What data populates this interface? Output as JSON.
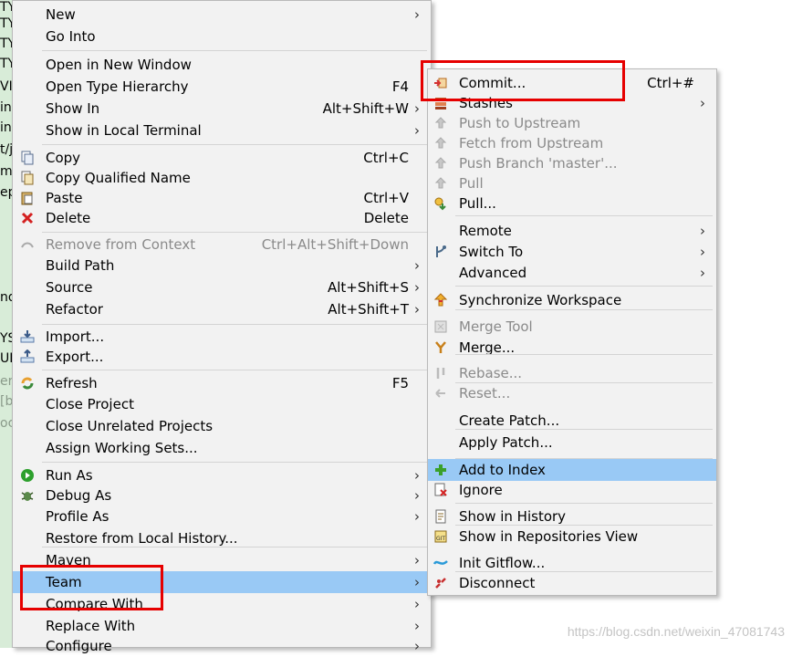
{
  "editor_fragments": [
    {
      "text": "TY",
      "muted": false
    },
    {
      "text": "TY",
      "muted": false
    },
    {
      "text": "TY",
      "muted": false
    },
    {
      "text": "TY",
      "muted": false
    },
    {
      "text": "VI",
      "muted": false
    },
    {
      "text": "in,",
      "muted": false
    },
    {
      "text": "in,",
      "muted": false
    },
    {
      "text": "t/j",
      "muted": false
    },
    {
      "text": "m",
      "muted": false
    },
    {
      "text": "ep",
      "muted": false
    },
    {
      "text": "nd",
      "muted": false
    },
    {
      "text": "YS",
      "muted": false
    },
    {
      "text": "UI",
      "muted": false
    },
    {
      "text": "er",
      "muted": true
    },
    {
      "text": "[b",
      "muted": true
    },
    {
      "text": "oc",
      "muted": true
    }
  ],
  "main_menu": {
    "items": [
      {
        "label": "New",
        "accel": "",
        "submenu": true,
        "disabled": false,
        "icon": ""
      },
      {
        "label": "Go Into",
        "accel": "",
        "submenu": false,
        "disabled": false,
        "icon": ""
      },
      {
        "label": "Open in New Window",
        "accel": "",
        "submenu": false,
        "disabled": false,
        "icon": ""
      },
      {
        "label": "Open Type Hierarchy",
        "accel": "F4",
        "submenu": false,
        "disabled": false,
        "icon": ""
      },
      {
        "label": "Show In",
        "accel": "Alt+Shift+W",
        "submenu": true,
        "disabled": false,
        "icon": ""
      },
      {
        "label": "Show in Local Terminal",
        "accel": "",
        "submenu": true,
        "disabled": false,
        "icon": ""
      },
      {
        "label": "Copy",
        "accel": "Ctrl+C",
        "submenu": false,
        "disabled": false,
        "icon": "copy-icon"
      },
      {
        "label": "Copy Qualified Name",
        "accel": "",
        "submenu": false,
        "disabled": false,
        "icon": "copy-qualified-icon"
      },
      {
        "label": "Paste",
        "accel": "Ctrl+V",
        "submenu": false,
        "disabled": false,
        "icon": "paste-icon"
      },
      {
        "label": "Delete",
        "accel": "Delete",
        "submenu": false,
        "disabled": false,
        "icon": "delete-icon"
      },
      {
        "label": "Remove from Context",
        "accel": "Ctrl+Alt+Shift+Down",
        "submenu": false,
        "disabled": true,
        "icon": "remove-context-icon"
      },
      {
        "label": "Build Path",
        "accel": "",
        "submenu": true,
        "disabled": false,
        "icon": ""
      },
      {
        "label": "Source",
        "accel": "Alt+Shift+S",
        "submenu": true,
        "disabled": false,
        "icon": ""
      },
      {
        "label": "Refactor",
        "accel": "Alt+Shift+T",
        "submenu": true,
        "disabled": false,
        "icon": ""
      },
      {
        "label": "Import...",
        "accel": "",
        "submenu": false,
        "disabled": false,
        "icon": "import-icon"
      },
      {
        "label": "Export...",
        "accel": "",
        "submenu": false,
        "disabled": false,
        "icon": "export-icon"
      },
      {
        "label": "Refresh",
        "accel": "F5",
        "submenu": false,
        "disabled": false,
        "icon": "refresh-icon"
      },
      {
        "label": "Close Project",
        "accel": "",
        "submenu": false,
        "disabled": false,
        "icon": ""
      },
      {
        "label": "Close Unrelated Projects",
        "accel": "",
        "submenu": false,
        "disabled": false,
        "icon": ""
      },
      {
        "label": "Assign Working Sets...",
        "accel": "",
        "submenu": false,
        "disabled": false,
        "icon": ""
      },
      {
        "label": "Run As",
        "accel": "",
        "submenu": true,
        "disabled": false,
        "icon": "run-icon"
      },
      {
        "label": "Debug As",
        "accel": "",
        "submenu": true,
        "disabled": false,
        "icon": "debug-icon"
      },
      {
        "label": "Profile As",
        "accel": "",
        "submenu": true,
        "disabled": false,
        "icon": ""
      },
      {
        "label": "Restore from Local History...",
        "accel": "",
        "submenu": false,
        "disabled": false,
        "icon": ""
      },
      {
        "label": "Maven",
        "accel": "",
        "submenu": true,
        "disabled": false,
        "icon": ""
      },
      {
        "label": "Team",
        "accel": "",
        "submenu": true,
        "disabled": false,
        "icon": "",
        "highlighted": true
      },
      {
        "label": "Compare With",
        "accel": "",
        "submenu": true,
        "disabled": false,
        "icon": ""
      },
      {
        "label": "Replace With",
        "accel": "",
        "submenu": true,
        "disabled": false,
        "icon": ""
      },
      {
        "label": "Configure",
        "accel": "",
        "submenu": true,
        "disabled": false,
        "icon": ""
      }
    ]
  },
  "team_menu": {
    "items": [
      {
        "label": "Commit...",
        "accel": "Ctrl+#",
        "submenu": false,
        "disabled": false,
        "icon": "commit-icon"
      },
      {
        "label": "Stashes",
        "accel": "",
        "submenu": true,
        "disabled": false,
        "icon": "stashes-icon"
      },
      {
        "label": "Push to Upstream",
        "accel": "",
        "submenu": false,
        "disabled": true,
        "icon": "push-icon"
      },
      {
        "label": "Fetch from Upstream",
        "accel": "",
        "submenu": false,
        "disabled": true,
        "icon": "fetch-icon"
      },
      {
        "label": "Push Branch 'master'...",
        "accel": "",
        "submenu": false,
        "disabled": true,
        "icon": "push-branch-icon"
      },
      {
        "label": "Pull",
        "accel": "",
        "submenu": false,
        "disabled": true,
        "icon": "pull-icon"
      },
      {
        "label": "Pull...",
        "accel": "",
        "submenu": false,
        "disabled": false,
        "icon": "pull-dialog-icon"
      },
      {
        "label": "Remote",
        "accel": "",
        "submenu": true,
        "disabled": false,
        "icon": ""
      },
      {
        "label": "Switch To",
        "accel": "",
        "submenu": true,
        "disabled": false,
        "icon": "switch-branch-icon"
      },
      {
        "label": "Advanced",
        "accel": "",
        "submenu": true,
        "disabled": false,
        "icon": ""
      },
      {
        "label": "Synchronize Workspace",
        "accel": "",
        "submenu": false,
        "disabled": false,
        "icon": "synchronize-icon"
      },
      {
        "label": "Merge Tool",
        "accel": "",
        "submenu": false,
        "disabled": true,
        "icon": "merge-tool-icon"
      },
      {
        "label": "Merge...",
        "accel": "",
        "submenu": false,
        "disabled": false,
        "icon": "merge-icon"
      },
      {
        "label": "Rebase...",
        "accel": "",
        "submenu": false,
        "disabled": true,
        "icon": "rebase-icon"
      },
      {
        "label": "Reset...",
        "accel": "",
        "submenu": false,
        "disabled": true,
        "icon": "reset-icon"
      },
      {
        "label": "Create Patch...",
        "accel": "",
        "submenu": false,
        "disabled": false,
        "icon": ""
      },
      {
        "label": "Apply Patch...",
        "accel": "",
        "submenu": false,
        "disabled": false,
        "icon": ""
      },
      {
        "label": "Add to Index",
        "accel": "",
        "submenu": false,
        "disabled": false,
        "icon": "add-index-icon",
        "highlighted": true
      },
      {
        "label": "Ignore",
        "accel": "",
        "submenu": false,
        "disabled": false,
        "icon": "ignore-icon"
      },
      {
        "label": "Show in History",
        "accel": "",
        "submenu": false,
        "disabled": false,
        "icon": "history-icon"
      },
      {
        "label": "Show in Repositories View",
        "accel": "",
        "submenu": false,
        "disabled": false,
        "icon": "repositories-icon"
      },
      {
        "label": "Init Gitflow...",
        "accel": "",
        "submenu": false,
        "disabled": false,
        "icon": "gitflow-icon"
      },
      {
        "label": "Disconnect",
        "accel": "",
        "submenu": false,
        "disabled": false,
        "icon": "disconnect-icon"
      }
    ]
  },
  "submenu_arrow": "›",
  "watermark": "https://blog.csdn.net/weixin_47081743",
  "colors": {
    "highlight": "#99c9f5",
    "callout": "#e60000",
    "menu_bg": "#f2f2f2",
    "disabled_text": "#8a8a8a"
  }
}
